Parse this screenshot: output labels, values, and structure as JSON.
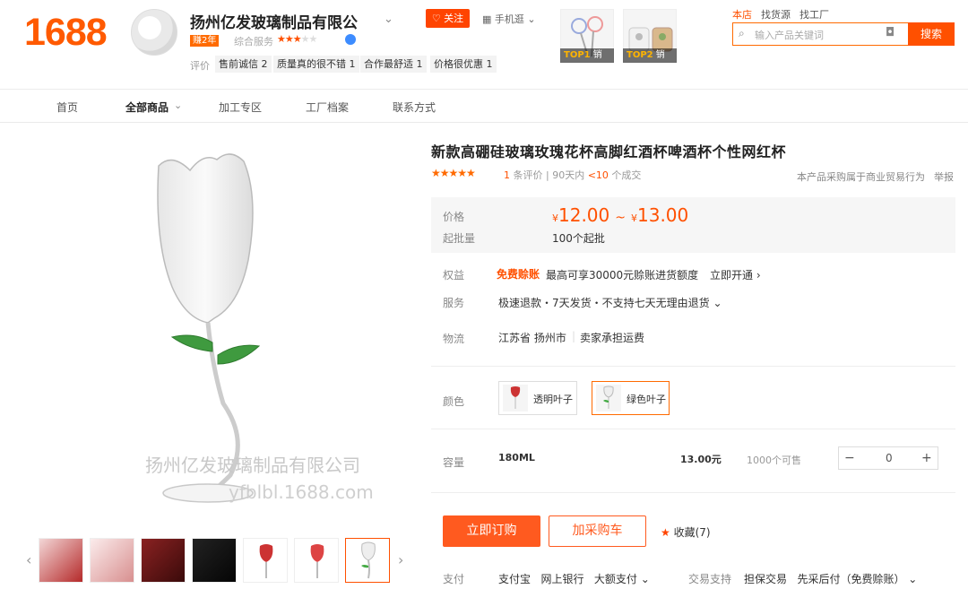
{
  "header": {
    "logo": "1688",
    "shop_name": "扬州亿发玻璃制品有限公",
    "badge_years": "赚2年",
    "service_label": "综合服务",
    "follow_label": "关注",
    "mobile_label": "手机逛",
    "eval_label": "评价",
    "tags": [
      "售前诚信 2",
      "质量真的很不错 1",
      "合作最舒适 1",
      "价格很优惠 1"
    ],
    "top_items": [
      {
        "label": "TOP1",
        "sub": "销量"
      },
      {
        "label": "TOP2",
        "sub": "销量"
      }
    ],
    "search_tabs": [
      "本店",
      "找货源",
      "找工厂"
    ],
    "search_placeholder": "输入产品关键词",
    "search_button": "搜索"
  },
  "nav": {
    "items": [
      "首页",
      "全部商品",
      "加工专区",
      "工厂档案",
      "联系方式"
    ]
  },
  "image": {
    "watermark_line1": "扬州亿发玻璃制品有限公司",
    "watermark_line2": "yfblbl.1688.com"
  },
  "product": {
    "title": "新款高硼硅玻璃玫瑰花杯高脚红酒杯啤酒杯个性网红杯",
    "rating_count": "1",
    "rating_text": "条评价",
    "sales_prefix": "90天内",
    "sales_value": "<10",
    "sales_suffix": "个成交",
    "business_note": "本产品采购属于商业贸易行为",
    "report": "举报",
    "price_label": "价格",
    "price_low": "12.00",
    "price_high": "13.00",
    "currency": "¥",
    "moq_label": "起批量",
    "moq_value": "100个起批",
    "rights_label": "权益",
    "rights_free": "免费赊账",
    "rights_text": "最高可享30000元赊账进货额度",
    "rights_link": "立即开通 ›",
    "service_label": "服务",
    "service_text": "极速退款・7天发货・不支持七天无理由退货 ⌄",
    "logistics_label": "物流",
    "logistics_place": "江苏省 扬州市",
    "logistics_fee": "卖家承担运费",
    "color_label": "颜色",
    "colors": [
      "透明叶子",
      "绿色叶子"
    ],
    "capacity_label": "容量",
    "capacity_value": "180ML",
    "capacity_price": "13.00元",
    "stock": "1000个可售",
    "quantity": "0",
    "buy_now": "立即订购",
    "add_cart": "加采购车",
    "favorite": "收藏(7)",
    "pay_label": "支付",
    "pay_methods": "支付宝   网上银行   大额支付 ⌄",
    "trade_label": "交易支持",
    "trade_methods": "担保交易   先采后付（免费赊账） ⌄"
  }
}
